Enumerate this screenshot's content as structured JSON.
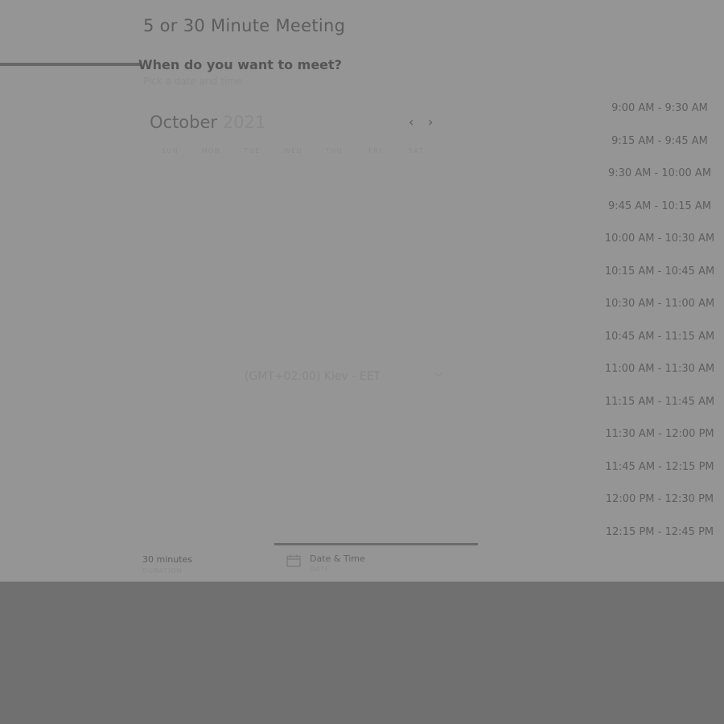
{
  "meeting": {
    "title": "5 or 30 Minute Meeting",
    "question": "When do you want to meet?",
    "subtitle": "Pick a date and time"
  },
  "calendar": {
    "month": "October",
    "year": "2021",
    "prev_icon": "chevron-left-icon",
    "next_icon": "chevron-right-icon",
    "weekdays": [
      "SUN",
      "MON",
      "TUE",
      "WED",
      "THU",
      "FRI",
      "SAT"
    ]
  },
  "timezone": {
    "value": "(GMT+02:00) Kiev - EET"
  },
  "time_slots": [
    "9:00 AM - 9:30 AM",
    "9:15 AM - 9:45 AM",
    "9:30 AM - 10:00 AM",
    "9:45 AM - 10:15 AM",
    "10:00 AM - 10:30 AM",
    "10:15 AM - 10:45 AM",
    "10:30 AM - 11:00 AM",
    "10:45 AM - 11:15 AM",
    "11:00 AM - 11:30 AM",
    "11:15 AM - 11:45 AM",
    "11:30 AM - 12:00 PM",
    "11:45 AM - 12:15 PM",
    "12:00 PM - 12:30 PM",
    "12:15 PM - 12:45 PM"
  ],
  "footer": {
    "duration": "30 minutes",
    "duration_sub": "DURATION",
    "step_label": "Date & Time",
    "step_sub": "DATE"
  }
}
